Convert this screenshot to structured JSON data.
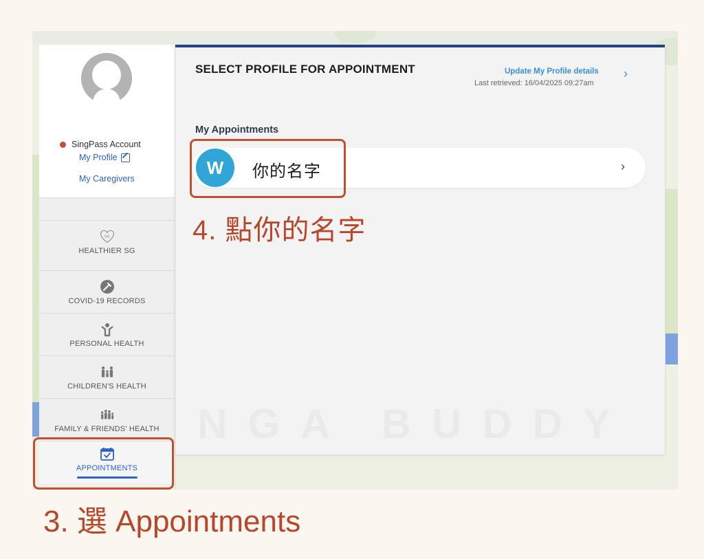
{
  "sidebar": {
    "account_label": "SingPass Account",
    "my_profile": "My Profile",
    "my_caregivers": "My Caregivers",
    "nav": [
      {
        "label": "HEALTHIER SG",
        "icon": "healthier-sg-badge-icon"
      },
      {
        "label": "COVID-19 RECORDS",
        "icon": "syringe-icon"
      },
      {
        "label": "PERSONAL HEALTH",
        "icon": "person-heart-icon"
      },
      {
        "label": "CHILDREN'S HEALTH",
        "icon": "family-icon"
      },
      {
        "label": "FAMILY & FRIENDS' HEALTH",
        "icon": "group-icon"
      },
      {
        "label": "APPOINTMENTS",
        "icon": "calendar-check-icon",
        "active": true
      }
    ],
    "healthier_badge_text": "SG"
  },
  "main": {
    "title": "SELECT PROFILE FOR APPOINTMENT",
    "update_link": "Update My Profile details",
    "last_retrieved": "Last retrieved: 16/04/2025 09:27am",
    "section_label": "My Appointments",
    "patient": {
      "initial": "W",
      "name": "你的名字"
    }
  },
  "watermark": "NGA BUDDY",
  "captions": {
    "step4": "4. 點你的名字",
    "step3": "3. 選 Appointments"
  },
  "colors": {
    "accent_blue": "#2c64c8",
    "header_bar": "#1f3f8f",
    "avatar_circle": "#2fa6d6",
    "highlight": "#c1502f",
    "caption": "#b7472a"
  }
}
